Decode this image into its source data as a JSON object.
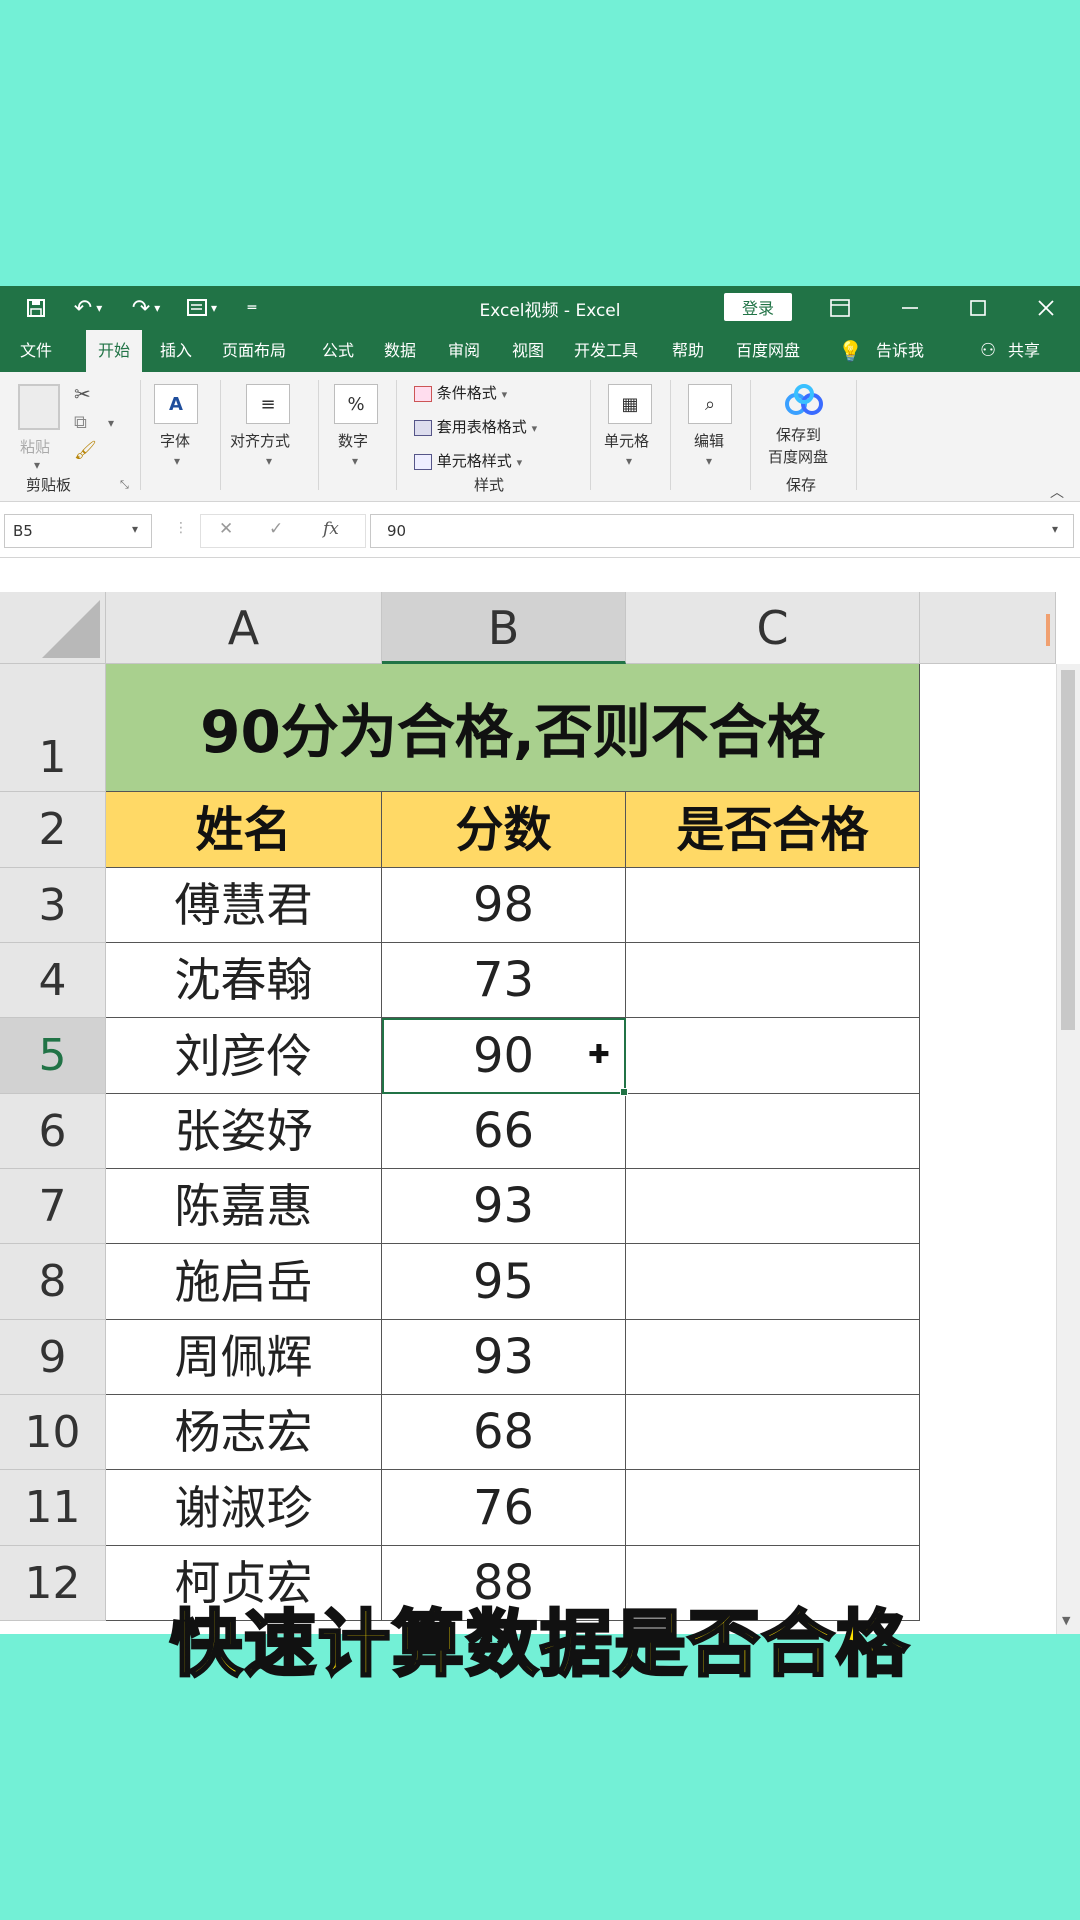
{
  "window": {
    "title": "Excel视频  -  Excel",
    "login_label": "登录",
    "min_icon": "minimize-icon",
    "max_icon": "maximize-icon",
    "close_icon": "close-icon"
  },
  "menu": {
    "items": [
      "文件",
      "开始",
      "插入",
      "页面布局",
      "公式",
      "数据",
      "审阅",
      "视图",
      "开发工具",
      "帮助",
      "百度网盘"
    ],
    "active": "开始",
    "tell_me": "告诉我",
    "share": "共享"
  },
  "ribbon": {
    "clipboard": {
      "paste": "粘贴",
      "group": "剪贴板"
    },
    "font": {
      "label": "字体"
    },
    "align": {
      "label": "对齐方式"
    },
    "number": {
      "label": "数字"
    },
    "styles": {
      "items": [
        "条件格式",
        "套用表格格式",
        "单元格样式"
      ],
      "group": "样式"
    },
    "cells": {
      "label": "单元格"
    },
    "edit": {
      "label": "编辑"
    },
    "save": {
      "line1": "保存到",
      "line2": "百度网盘",
      "group": "保存"
    }
  },
  "formula_bar": {
    "name_box": "B5",
    "formula": "90"
  },
  "sheet": {
    "columns": [
      "A",
      "B",
      "C"
    ],
    "row_numbers": [
      "1",
      "2",
      "3",
      "4",
      "5",
      "6",
      "7",
      "8",
      "9",
      "10",
      "11",
      "12"
    ],
    "title": "90分为合格,否则不合格",
    "headers": [
      "姓名",
      "分数",
      "是否合格"
    ],
    "rows": [
      {
        "name": "傅慧君",
        "score": "98"
      },
      {
        "name": "沈春翰",
        "score": "73"
      },
      {
        "name": "刘彦伶",
        "score": "90"
      },
      {
        "name": "张姿妤",
        "score": "66"
      },
      {
        "name": "陈嘉惠",
        "score": "93"
      },
      {
        "name": "施启岳",
        "score": "95"
      },
      {
        "name": "周佩辉",
        "score": "93"
      },
      {
        "name": "杨志宏",
        "score": "68"
      },
      {
        "name": "谢淑珍",
        "score": "76"
      },
      {
        "name": "柯贞宏",
        "score": "88"
      }
    ],
    "selected_cell": "B5",
    "title_fill": "#a9d08e",
    "header_fill": "#ffd966"
  },
  "caption": "快速计算数据是否合格"
}
